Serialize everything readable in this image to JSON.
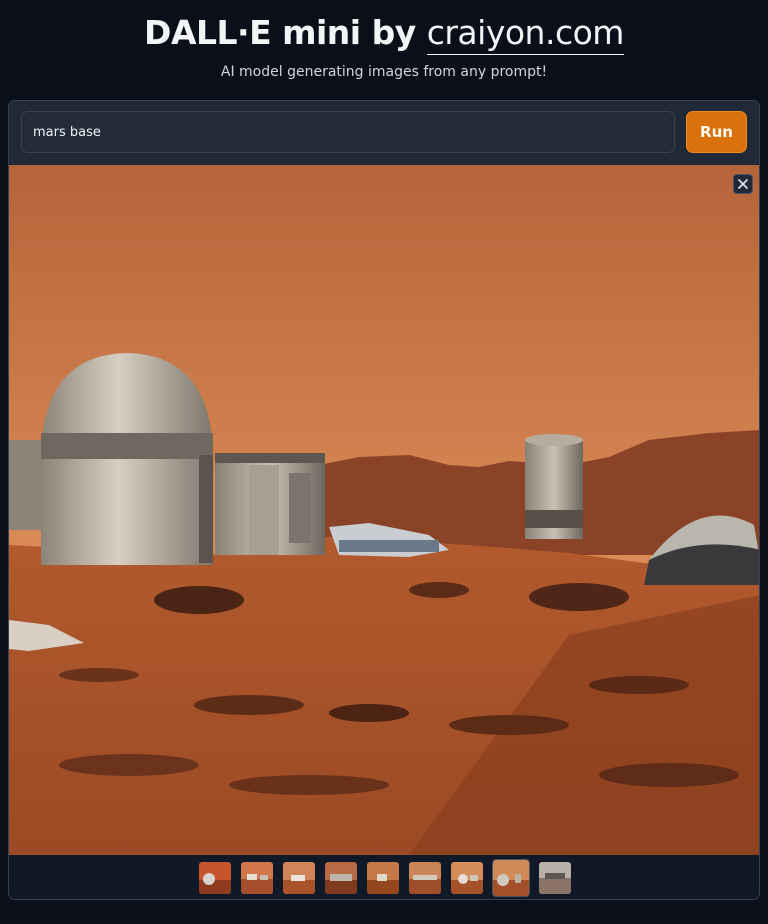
{
  "header": {
    "title_prefix": "DALL·E mini by ",
    "brand": "craiyon.com",
    "subtitle": "AI model generating images from any prompt!"
  },
  "prompt": {
    "value": "mars base",
    "placeholder": ""
  },
  "run_button": {
    "label": "Run"
  },
  "gallery": {
    "count": 9,
    "selected_index": 7
  },
  "colors": {
    "accent": "#d9720c",
    "background": "#0b0f19",
    "panel": "#1f2937"
  }
}
